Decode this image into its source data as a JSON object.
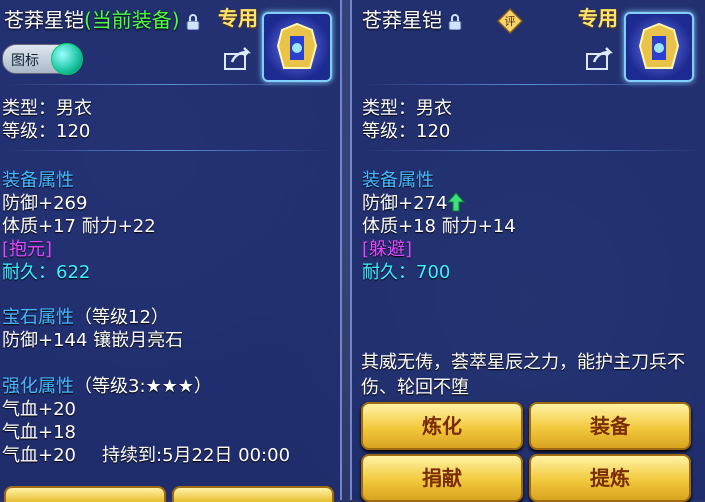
{
  "left": {
    "name": "苍莽星铠",
    "current_tag": "(当前装备)",
    "special_label": "专用",
    "icon_toggle_label": "图标",
    "type": "类型：男衣",
    "level": "等级：120",
    "attr_header": "装备属性",
    "defense": "防御+269",
    "constitution_endurance": "体质+17 耐力+22",
    "special_skill": "[抱元]",
    "durability": "耐久：622",
    "gem_header": "宝石属性",
    "gem_level": "（等级12）",
    "gem_detail": "防御+144 镶嵌月亮石",
    "enhance_header": "强化属性",
    "enhance_level": "（等级3:★★★）",
    "enhance_1": "气血+20",
    "enhance_2": "气血+18",
    "enhance_3": "气血+20",
    "enhance_duration": "持续到:5月22日 00:00"
  },
  "right": {
    "name": "苍莽星铠",
    "rate_label": "评",
    "special_label": "专用",
    "type": "类型：男衣",
    "level": "等级：120",
    "attr_header": "装备属性",
    "defense": "防御+274",
    "constitution_endurance": "体质+18 耐力+14",
    "special_skill": "[躲避]",
    "durability": "耐久：700",
    "description": "其威无俦，荟萃星辰之力，能护主刀兵不伤、轮回不堕",
    "buttons": {
      "refine": "炼化",
      "equip": "装备",
      "donate": "捐献",
      "extract": "提炼"
    }
  },
  "colors": {
    "gold_text": "#ffe36a",
    "attr_blue": "#46b8ff",
    "skill_purple": "#e04bff",
    "durability_cyan": "#3ff0ff",
    "current_green": "#4dff3e"
  }
}
